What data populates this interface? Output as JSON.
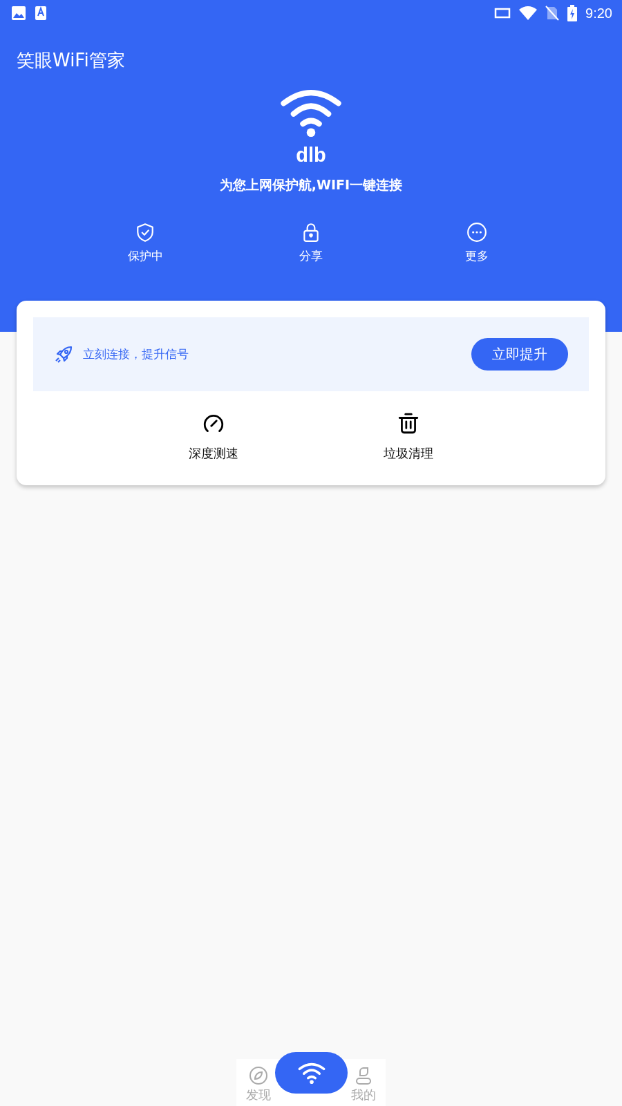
{
  "status_bar": {
    "time": "9:20"
  },
  "app_title": "笑眼WiFi管家",
  "network": {
    "name": "dlb",
    "slogan": "为您上网保护航,WIFI一键连接"
  },
  "actions": [
    {
      "kind": "shield",
      "label": "保护中"
    },
    {
      "kind": "lock",
      "label": "分享"
    },
    {
      "kind": "more",
      "label": "更多"
    }
  ],
  "boost": {
    "text": "立刻连接，提升信号",
    "button": "立即提升"
  },
  "tools": [
    {
      "kind": "speed",
      "label": "深度测速"
    },
    {
      "kind": "trash",
      "label": "垃圾清理"
    }
  ],
  "bottom_nav": [
    {
      "kind": "discover",
      "label": "发现"
    },
    {
      "kind": "wifi"
    },
    {
      "kind": "profile",
      "label": "我的"
    }
  ]
}
